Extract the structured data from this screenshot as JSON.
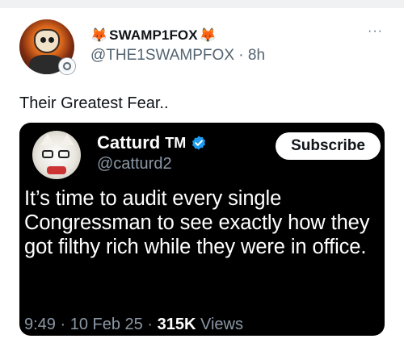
{
  "author": {
    "fox_emoji_left": "🦊",
    "display_name": "SWAMP1FOX",
    "fox_emoji_right": "🦊",
    "handle": "@THE1SWAMPFOX",
    "separator": "·",
    "time": "8h",
    "more_label": "···"
  },
  "tweet": {
    "text": "Their Greatest Fear.."
  },
  "quoted": {
    "display_name": "Catturd",
    "tm": "TM",
    "handle": "@catturd2",
    "subscribe_label": "Subscribe",
    "body": "It’s time to audit every single Congressman to see exactly how they got filthy rich while they were in office.",
    "time": "9:49",
    "dot1": "·",
    "date": "10 Feb 25",
    "dot2": "·",
    "views_count": "315K",
    "views_label": "Views"
  },
  "colors": {
    "verified_blue": "#1d9bf0",
    "muted_gray": "#536471",
    "card_bg": "#000000"
  }
}
